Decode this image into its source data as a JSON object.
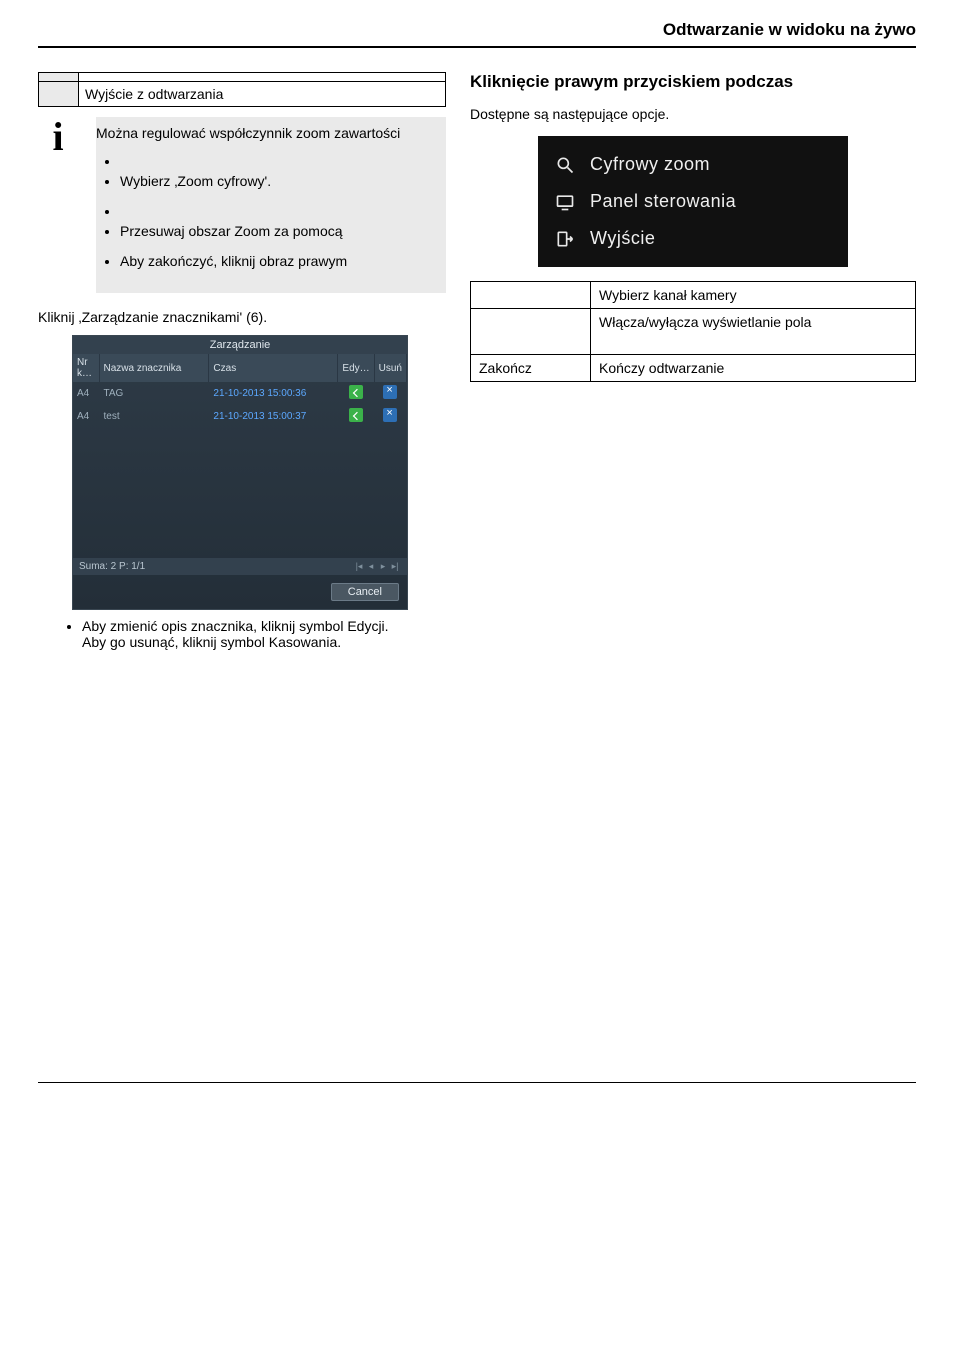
{
  "header": {
    "title": "Odtwarzanie w widoku na żywo"
  },
  "left": {
    "table_row_label": "Wyjście z odtwarzania",
    "info_text": "Można regulować współczynnik zoom zawartości",
    "bullets": {
      "b2": "Wybierz ‚Zoom cyfrowy'.",
      "b4": "Przesuwaj obszar Zoom za pomocą",
      "b5": "Aby zakończyć, kliknij obraz prawym"
    },
    "markers_intro": "Kliknij ‚Zarządzanie znacznikami' (6).",
    "dialog": {
      "title": "Zarządzanie",
      "cols": {
        "ch": "Nr k…",
        "name": "Nazwa znacznika",
        "time": "Czas",
        "edit": "Edy…",
        "del": "Usuń"
      },
      "rows": [
        {
          "ch": "A4",
          "name": "TAG",
          "time": "21-10-2013 15:00:36"
        },
        {
          "ch": "A4",
          "name": "test",
          "time": "21-10-2013 15:00:37"
        }
      ],
      "status": "Suma: 2 P: 1/1",
      "cancel": "Cancel"
    },
    "post_dialog_bullet_1": "Aby zmienić opis znacznika, kliknij symbol Edycji.",
    "post_dialog_bullet_2": "Aby go usunąć, kliknij symbol Kasowania."
  },
  "right": {
    "heading": "Kliknięcie prawym przyciskiem podczas",
    "intro": "Dostępne są następujące opcje.",
    "menu": {
      "zoom": "Cyfrowy zoom",
      "panel": "Panel sterowania",
      "exit": "Wyjście"
    },
    "table": {
      "r1_left": "",
      "r1_right": "Wybierz kanał kamery",
      "r2_left": "",
      "r2_right": "Włącza/wyłącza wyświetlanie pola",
      "r3_left": "Zakończ",
      "r3_right": "Kończy odtwarzanie"
    }
  }
}
